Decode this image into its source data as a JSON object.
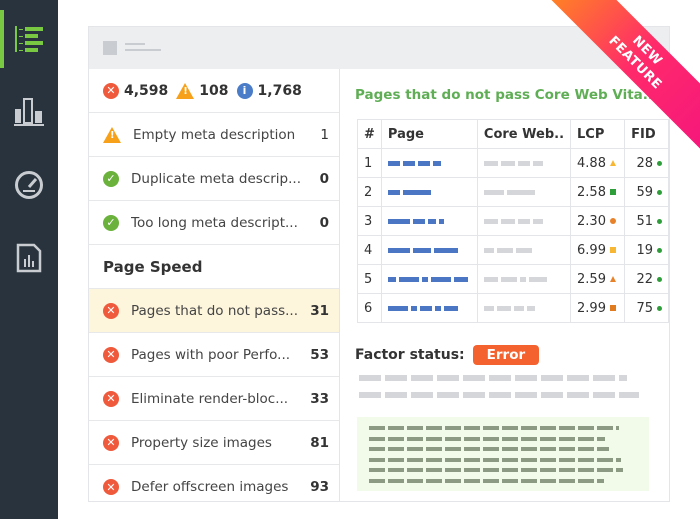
{
  "sidebar": {
    "items": [
      {
        "icon": "list-icon",
        "active": true
      },
      {
        "icon": "bar-chart-icon"
      },
      {
        "icon": "speedometer-icon"
      },
      {
        "icon": "report-icon"
      }
    ],
    "accent": "#7ac943"
  },
  "summary": {
    "errors": "4,598",
    "warnings": "108",
    "info": "1,768"
  },
  "issues": [
    {
      "status": "warning",
      "label": "Empty meta description",
      "count": "1"
    },
    {
      "status": "ok",
      "label": "Duplicate meta descrip...",
      "count": "0"
    },
    {
      "status": "ok",
      "label": "Too long meta descript...",
      "count": "0"
    }
  ],
  "section_title": "Page Speed",
  "speed_issues": [
    {
      "status": "error",
      "label": "Pages that do not pass...",
      "count": "31",
      "selected": true
    },
    {
      "status": "error",
      "label": "Pages with poor Perfo...",
      "count": "53"
    },
    {
      "status": "error",
      "label": "Eliminate render-bloc...",
      "count": "33"
    },
    {
      "status": "error",
      "label": "Property size images",
      "count": "81"
    },
    {
      "status": "error",
      "label": "Defer offscreen images",
      "count": "93"
    }
  ],
  "detail": {
    "title": "Pages that do not pass Core Web Vita...",
    "columns": [
      "#",
      "Page",
      "Core Web..",
      "LCP",
      "FID"
    ],
    "rows": [
      {
        "n": "1",
        "lcp": "4.88",
        "lcp_marker": "triangle",
        "lcp_color": "#f7b733",
        "fid": "28"
      },
      {
        "n": "2",
        "lcp": "2.58",
        "lcp_marker": "square",
        "lcp_color": "#2e9e3a",
        "fid": "59"
      },
      {
        "n": "3",
        "lcp": "2.30",
        "lcp_marker": "circle",
        "lcp_color": "#e8822a",
        "fid": "51"
      },
      {
        "n": "4",
        "lcp": "6.99",
        "lcp_marker": "square",
        "lcp_color": "#f7b733",
        "fid": "19"
      },
      {
        "n": "5",
        "lcp": "2.59",
        "lcp_marker": "triangle",
        "lcp_color": "#e8822a",
        "fid": "22"
      },
      {
        "n": "6",
        "lcp": "2.99",
        "lcp_marker": "square",
        "lcp_color": "#e07b1f",
        "fid": "75"
      }
    ],
    "fid_color": "#2e9e3a",
    "factor_label": "Factor status:",
    "factor_value": "Error",
    "factor_color": "#f4622f"
  },
  "ribbon": {
    "line1": "NEW",
    "line2": "FEATURE"
  }
}
